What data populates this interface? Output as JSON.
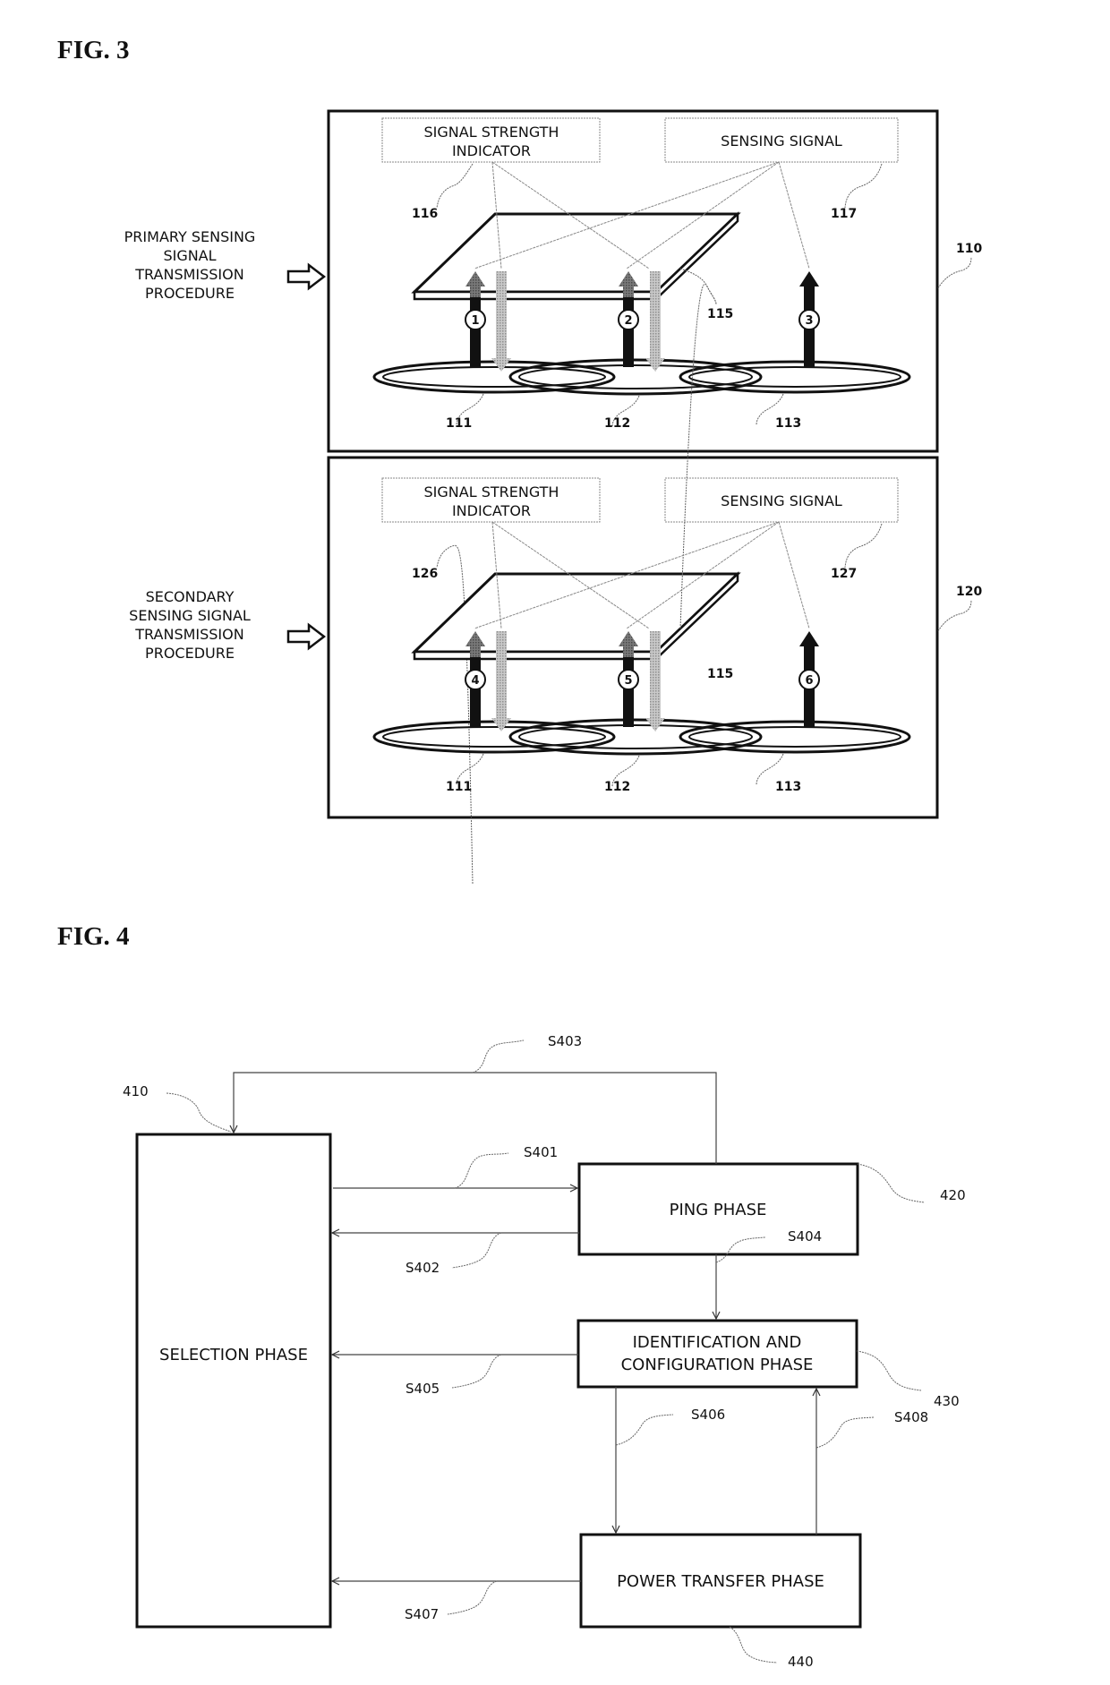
{
  "fig3": {
    "title": "FIG. 3",
    "panels": [
      {
        "ref": "110",
        "side_label": [
          "PRIMARY SENSING",
          "SIGNAL",
          "TRANSMISSION",
          "PROCEDURE"
        ],
        "ssi_box": {
          "lines": [
            "SIGNAL STRENGTH",
            "INDICATOR"
          ],
          "ref": "116"
        },
        "sensing_box": {
          "lines": [
            "SENSING SIGNAL"
          ],
          "ref": "117"
        },
        "plate_ref": "115",
        "coil_refs": [
          "111",
          "112",
          "113"
        ],
        "signal_markers": [
          "1",
          "2",
          "3"
        ]
      },
      {
        "ref": "120",
        "side_label": [
          "SECONDARY",
          "SENSING SIGNAL",
          "TRANSMISSION",
          "PROCEDURE"
        ],
        "ssi_box": {
          "lines": [
            "SIGNAL STRENGTH",
            "INDICATOR"
          ],
          "ref": "126"
        },
        "sensing_box": {
          "lines": [
            "SENSING SIGNAL"
          ],
          "ref": "127"
        },
        "plate_ref": "115",
        "coil_refs": [
          "111",
          "112",
          "113"
        ],
        "signal_markers": [
          "4",
          "5",
          "6"
        ]
      }
    ]
  },
  "fig4": {
    "title": "FIG. 4",
    "nodes": {
      "selection": {
        "label": [
          "SELECTION PHASE"
        ],
        "ref": "410"
      },
      "ping": {
        "label": [
          "PING PHASE"
        ],
        "ref": "420"
      },
      "idconfig": {
        "label": [
          "IDENTIFICATION AND",
          "CONFIGURATION PHASE"
        ],
        "ref": "430"
      },
      "power": {
        "label": [
          "POWER TRANSFER PHASE"
        ],
        "ref": "440"
      }
    },
    "edges": [
      {
        "id": "S401",
        "from": "selection",
        "to": "ping"
      },
      {
        "id": "S402",
        "from": "ping",
        "to": "selection"
      },
      {
        "id": "S403",
        "from": "ping",
        "to": "selection"
      },
      {
        "id": "S404",
        "from": "ping",
        "to": "idconfig"
      },
      {
        "id": "S405",
        "from": "idconfig",
        "to": "selection"
      },
      {
        "id": "S406",
        "from": "idconfig",
        "to": "power"
      },
      {
        "id": "S407",
        "from": "power",
        "to": "selection"
      },
      {
        "id": "S408",
        "from": "power",
        "to": "idconfig"
      }
    ]
  }
}
